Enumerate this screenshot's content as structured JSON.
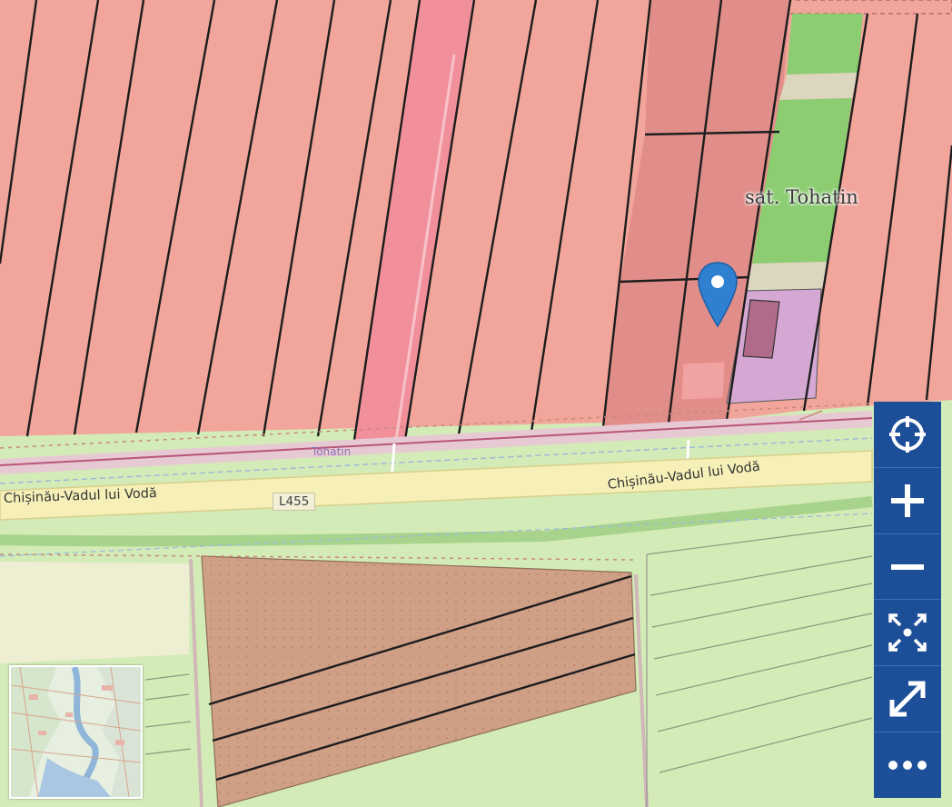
{
  "map": {
    "place_label": "sat. Tohatin",
    "village_label": "Tohatin",
    "road_label_left": "Chișinău-Vadul lui Vodă",
    "road_label_right": "Chișinău-Vadul lui Vodă",
    "road_ref": "L455"
  },
  "controls": [
    {
      "name": "locate-button",
      "icon": "crosshair-icon"
    },
    {
      "name": "zoom-in-button",
      "icon": "plus-icon"
    },
    {
      "name": "zoom-out-button",
      "icon": "minus-icon"
    },
    {
      "name": "fit-extent-button",
      "icon": "collapse-arrows-icon"
    },
    {
      "name": "fullscreen-button",
      "icon": "expand-arrows-icon"
    },
    {
      "name": "more-button",
      "icon": "ellipsis-icon"
    }
  ],
  "colors": {
    "agricultural_parcel": "#f2a59b",
    "green_area": "#8fce6f",
    "road_fill": "#f6f0b8",
    "control_bar": "#1d4f98",
    "marker": "#2f80d1"
  }
}
